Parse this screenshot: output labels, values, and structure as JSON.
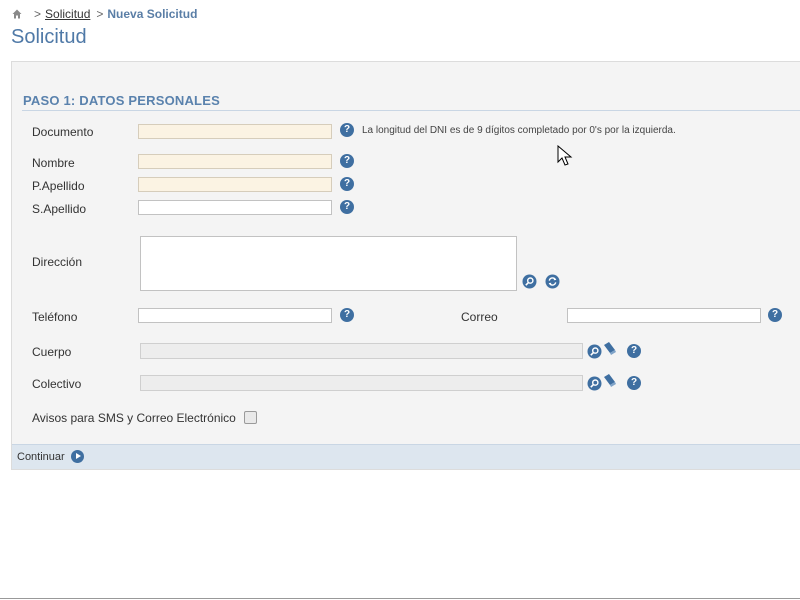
{
  "breadcrumb": {
    "separator": ">",
    "link": "Solicitud",
    "current": "Nueva Solicitud"
  },
  "page_title": "Solicitud",
  "step": {
    "title": "PASO 1: DATOS PERSONALES"
  },
  "fields": {
    "documento": {
      "label": "Documento",
      "value": "",
      "hint": "La longitud del DNI es de 9 dígitos completado por 0's por la izquierda."
    },
    "nombre": {
      "label": "Nombre",
      "value": ""
    },
    "p_apellido": {
      "label": "P.Apellido",
      "value": ""
    },
    "s_apellido": {
      "label": "S.Apellido",
      "value": ""
    },
    "direccion": {
      "label": "Dirección",
      "value": ""
    },
    "telefono": {
      "label": "Teléfono",
      "value": ""
    },
    "correo": {
      "label": "Correo",
      "value": ""
    },
    "cuerpo": {
      "label": "Cuerpo",
      "value": ""
    },
    "colectivo": {
      "label": "Colectivo",
      "value": ""
    },
    "avisos": {
      "label": "Avisos para SMS y Correo Electrónico",
      "checked": false
    }
  },
  "help_glyph": "?",
  "footer": {
    "continue_label": "Continuar"
  },
  "colors": {
    "accent": "#4f79a7",
    "required_field_bg": "#fbf3e3",
    "panel_bg": "#f4f4f4",
    "footer_bg": "#dde6ef"
  },
  "icons": {
    "home": "home-icon",
    "help": "help-icon",
    "search": "search-icon",
    "refresh": "refresh-icon",
    "eraser": "eraser-icon",
    "continue": "arrow-right-circle-icon"
  }
}
